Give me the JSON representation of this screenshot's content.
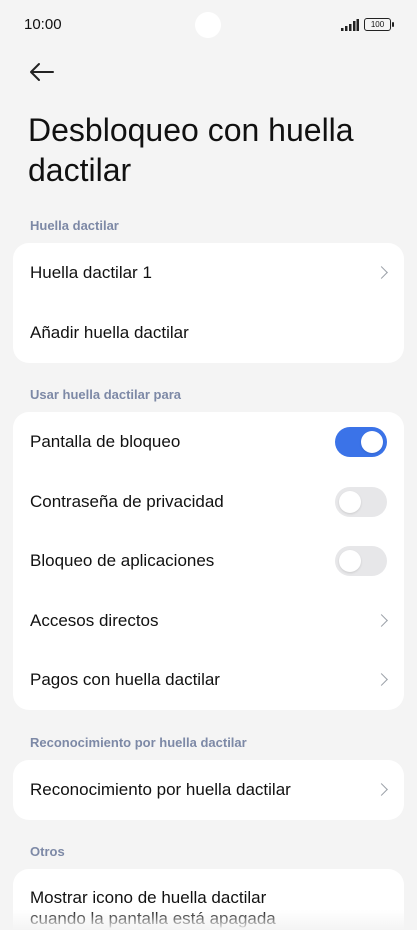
{
  "status": {
    "time": "10:00",
    "battery": "100"
  },
  "page": {
    "title": "Desbloqueo con huella dactilar"
  },
  "sections": {
    "fingerprint": {
      "label": "Huella dactilar",
      "items": [
        {
          "label": "Huella dactilar 1"
        },
        {
          "label": "Añadir huella dactilar"
        }
      ]
    },
    "use_for": {
      "label": "Usar huella dactilar para",
      "items": [
        {
          "label": "Pantalla de bloqueo",
          "toggle": true
        },
        {
          "label": "Contraseña de privacidad",
          "toggle": false
        },
        {
          "label": "Bloqueo de aplicaciones",
          "toggle": false
        },
        {
          "label": "Accesos directos"
        },
        {
          "label": "Pagos con huella dactilar"
        }
      ]
    },
    "recognition": {
      "label": "Reconocimiento por huella dactilar",
      "items": [
        {
          "label": "Reconocimiento por huella dactilar"
        }
      ]
    },
    "others": {
      "label": "Otros",
      "items": [
        {
          "label": "Mostrar icono de huella dactilar cuando la pantalla está apagada"
        }
      ]
    }
  },
  "colors": {
    "accent": "#3b73e8",
    "section_label": "#7d89a6",
    "background": "#f4f4f4"
  }
}
